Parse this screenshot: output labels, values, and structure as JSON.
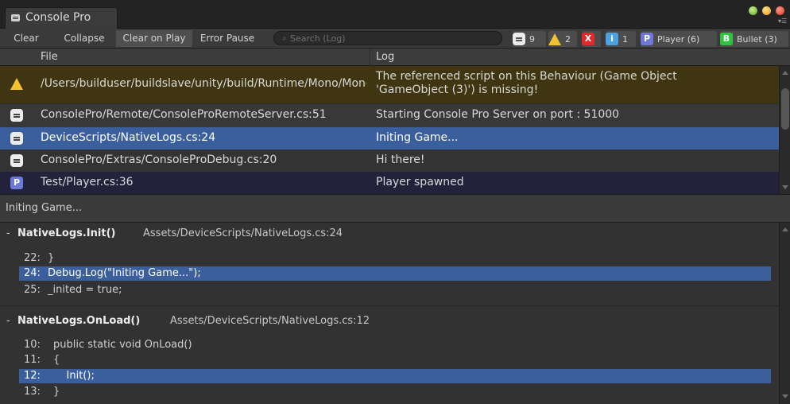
{
  "window": {
    "tab_title": "Console Pro"
  },
  "toolbar": {
    "clear": "Clear",
    "collapse": "Collapse",
    "clear_on_play": "Clear on Play",
    "error_pause": "Error Pause",
    "search_placeholder": "Search (Log)",
    "filters": [
      {
        "icon": "message-icon",
        "count": "9"
      },
      {
        "icon": "warning-icon",
        "count": "2"
      },
      {
        "icon": "error-icon",
        "count": ""
      },
      {
        "icon": "info-icon",
        "count": "1"
      },
      {
        "icon": "player-icon",
        "label": "Player (6)"
      },
      {
        "icon": "bullet-icon",
        "label": "Bullet (3)"
      }
    ]
  },
  "columns": {
    "file": "File",
    "log": "Log"
  },
  "log_rows": [
    {
      "type": "warning",
      "file": "/Users/builduser/buildslave/unity/build/Runtime/Mono/MonoBehaviour.cpp",
      "message_line1": "The referenced script on this Behaviour (Game Object",
      "message_line2": "'GameObject (3)') is missing!"
    },
    {
      "type": "message",
      "file": "ConsolePro/Remote/ConsoleProRemoteServer.cs:51",
      "message": "Starting Console Pro Server on port : 51000"
    },
    {
      "type": "message",
      "file": "DeviceScripts/NativeLogs.cs:24",
      "message": "Initing Game...",
      "selected": true
    },
    {
      "type": "message",
      "file": "ConsolePro/Extras/ConsoleProDebug.cs:20",
      "message": "Hi there!"
    },
    {
      "type": "player",
      "file": "Test/Player.cs:36",
      "message": "Player spawned"
    }
  ],
  "selected_message": "Initing Game...",
  "stack": [
    {
      "dash": "-",
      "function": "NativeLogs.Init()",
      "path": "Assets/DeviceScripts/NativeLogs.cs:24",
      "lines": [
        {
          "num": "22:",
          "code": "}"
        },
        {
          "num": "24:",
          "code": "Debug.Log(\"Initing Game...\");",
          "highlight": true
        },
        {
          "num": "25:",
          "code": "_inited = true;"
        }
      ]
    },
    {
      "dash": "-",
      "function": "NativeLogs.OnLoad()",
      "path": "Assets/DeviceScripts/NativeLogs.cs:12",
      "lines": [
        {
          "num": "10:",
          "code": "public static void OnLoad()"
        },
        {
          "num": "11:",
          "code": "{"
        },
        {
          "num": "12:",
          "code": "    Init();",
          "highlight": true
        },
        {
          "num": "13:",
          "code": "}"
        }
      ]
    }
  ],
  "colors": {
    "warning_row": "#3f3510",
    "selected_row": "#3a5f9c",
    "player_row": "#22233a",
    "code_highlight": "#3a5f9c"
  }
}
